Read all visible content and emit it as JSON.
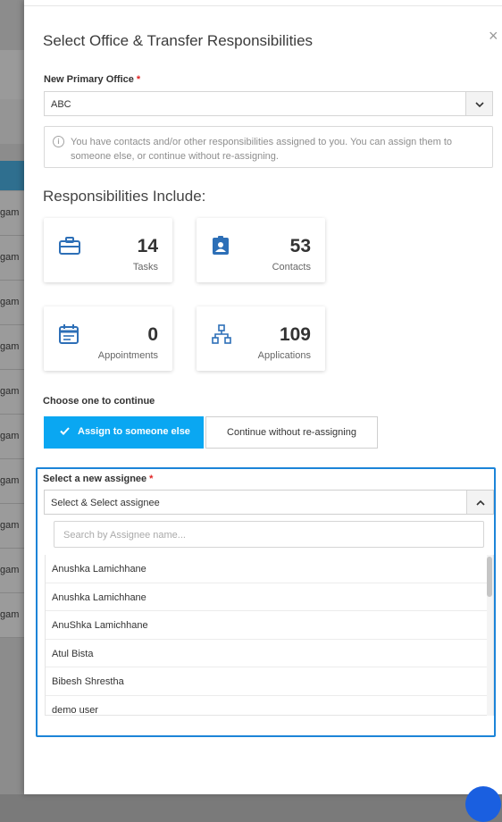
{
  "background": {
    "row_label": "gam",
    "rows": [
      "gam",
      "gam",
      "gam",
      "gam",
      "gam",
      "gam",
      "gam",
      "gam",
      "gam",
      "gam"
    ]
  },
  "modal": {
    "title": "Select Office & Transfer Responsibilities",
    "close_symbol": "×",
    "primary_office": {
      "label": "New Primary Office",
      "required_mark": "*",
      "value": "ABC"
    },
    "info": {
      "icon": "info-icon",
      "text": "You have contacts and/or other responsibilities assigned to you. You can assign them to someone else, or continue without re-assigning."
    },
    "responsibilities_title": "Responsibilities Include:",
    "stats": [
      {
        "icon": "briefcase-icon",
        "value": "14",
        "caption": "Tasks"
      },
      {
        "icon": "contact-badge-icon",
        "value": "53",
        "caption": "Contacts"
      },
      {
        "icon": "calendar-icon",
        "value": "0",
        "caption": "Appointments"
      },
      {
        "icon": "sitemap-icon",
        "value": "109",
        "caption": "Applications"
      }
    ],
    "choose_label": "Choose one to continue",
    "assign_button": "Assign to someone else",
    "continue_button": "Continue without re-assigning",
    "assignee": {
      "label": "Select a new assignee",
      "required_mark": "*",
      "selected": "Select & Select assignee",
      "search_placeholder": "Search by Assignee name...",
      "options": [
        "Anushka Lamichhane",
        "Anushka Lamichhane",
        "AnuShka Lamichhane",
        "Atul Bista",
        "Bibesh Shrestha",
        "demo user"
      ]
    }
  },
  "colors": {
    "accent": "#0aa7f2",
    "icon_blue": "#2d6fb7",
    "focus_border": "#1c84d8",
    "required": "#e02424"
  }
}
